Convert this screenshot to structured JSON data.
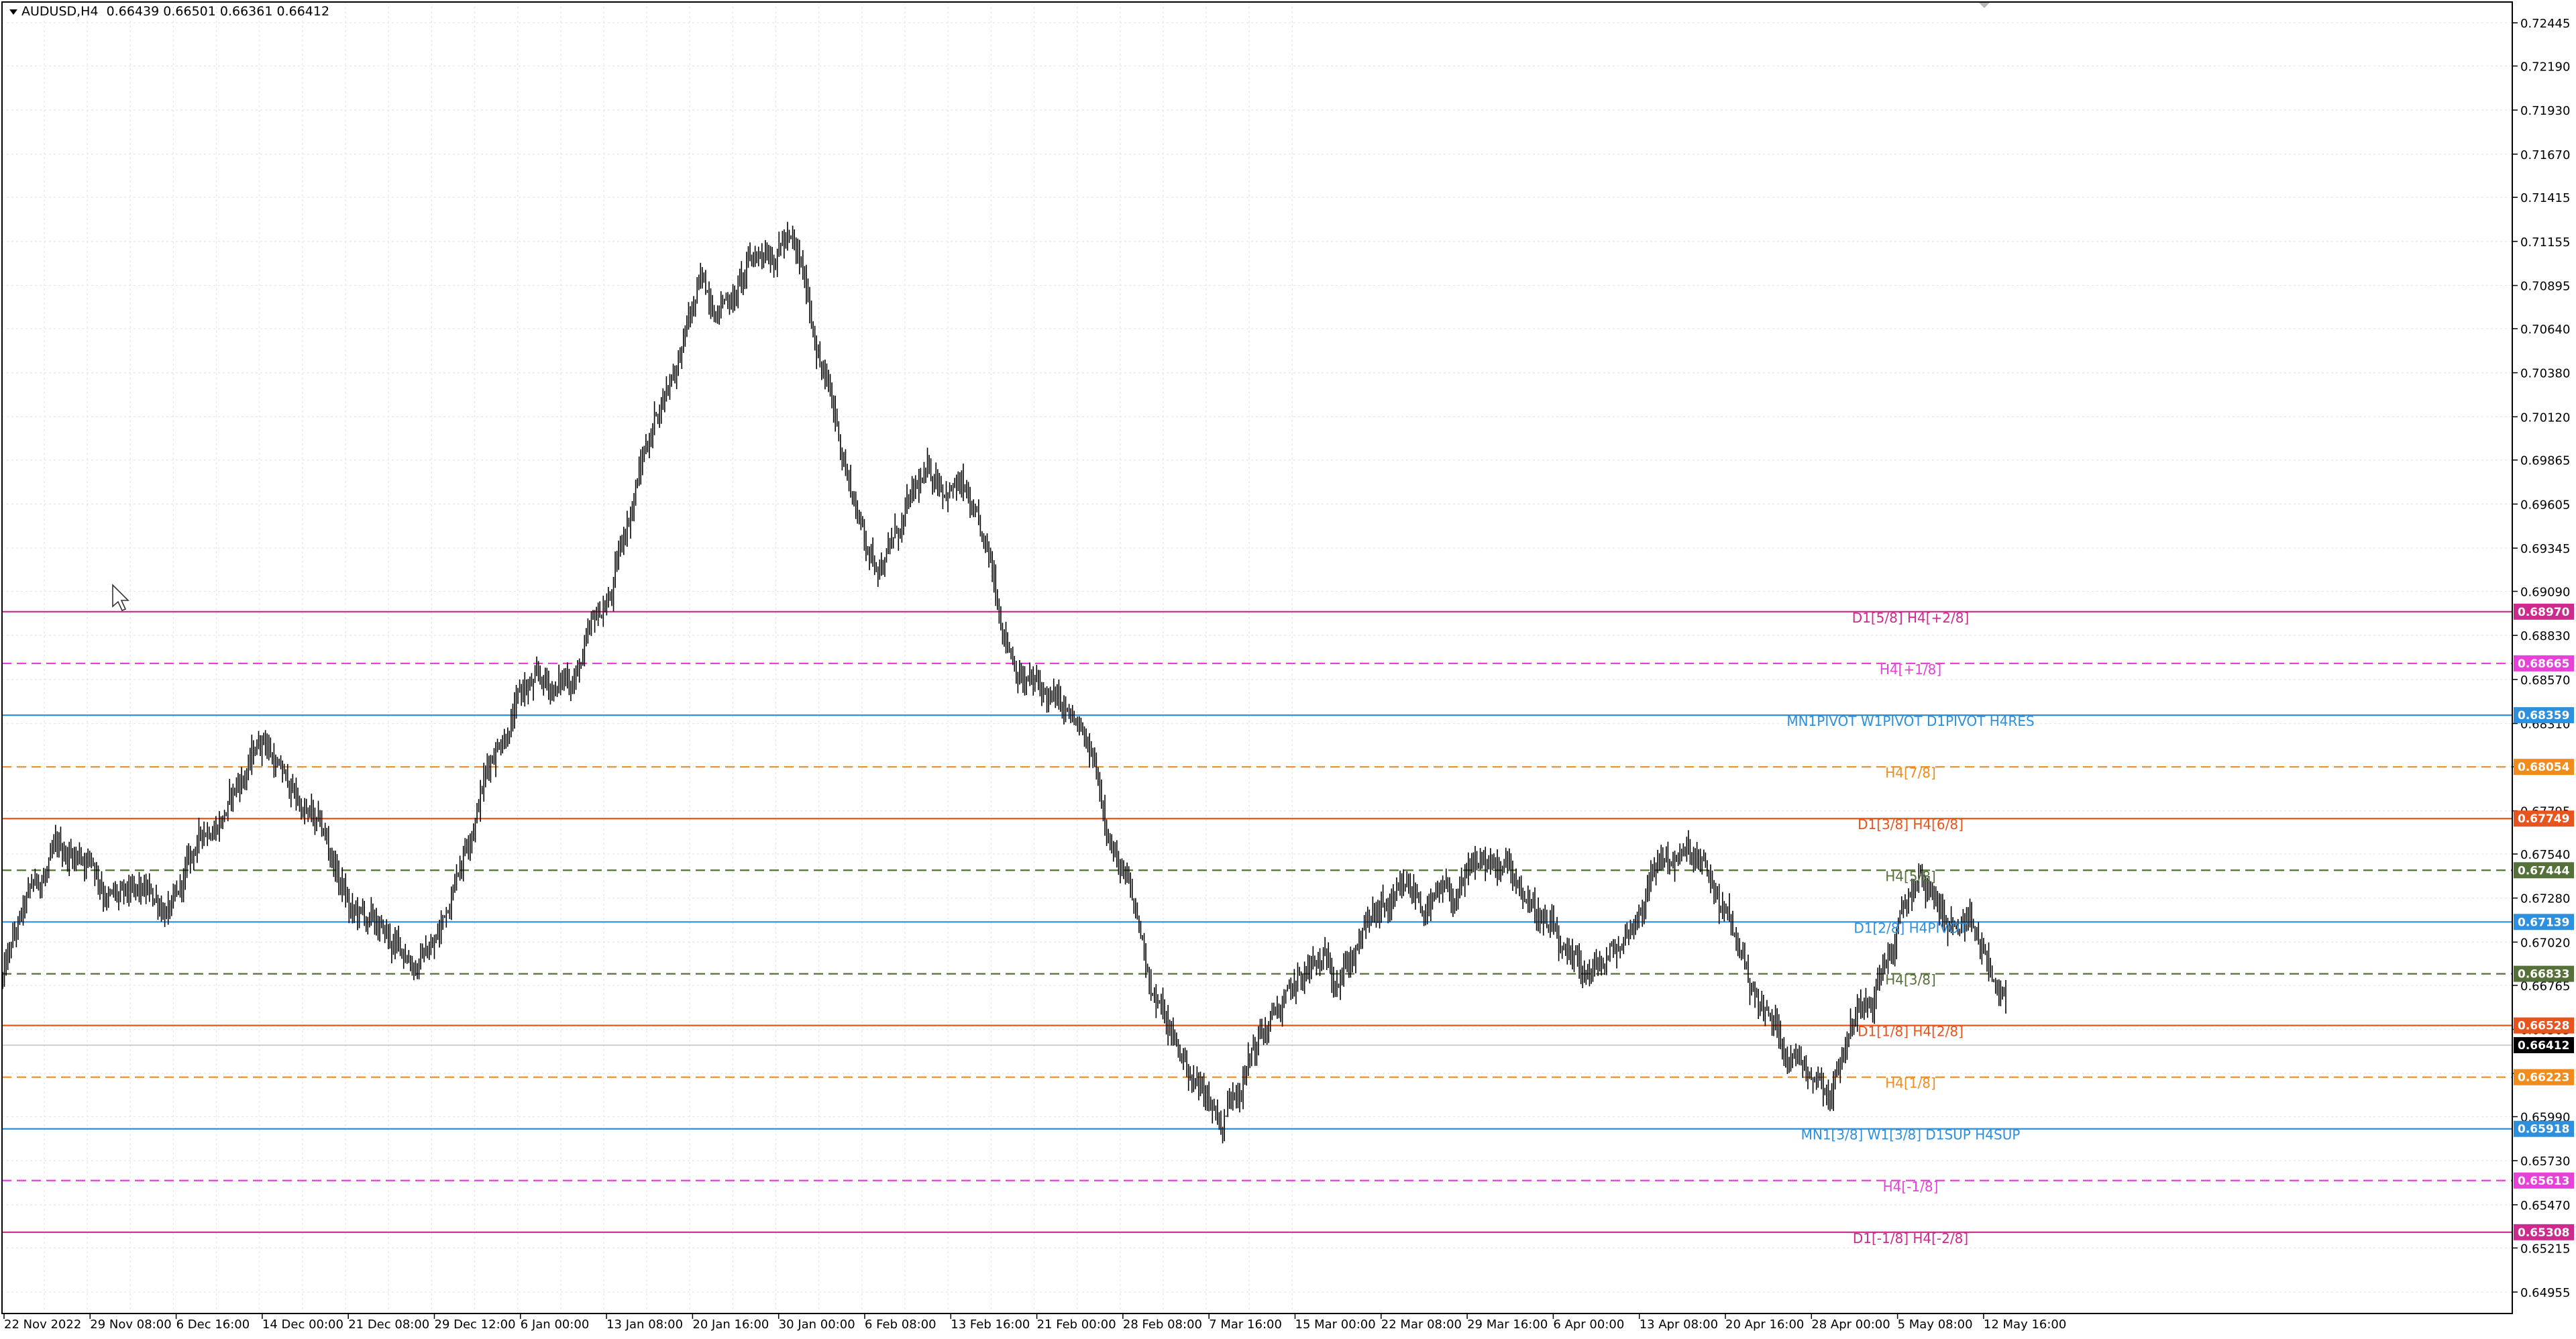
{
  "header": {
    "symbol_label": "AUDUSD,H4",
    "ohlc": "0.66439 0.66501 0.66361 0.66412"
  },
  "price_axis": {
    "ticks": [
      "0.72445",
      "0.72190",
      "0.71930",
      "0.71670",
      "0.71415",
      "0.71155",
      "0.70895",
      "0.70640",
      "0.70380",
      "0.70120",
      "0.69865",
      "0.69605",
      "0.69345",
      "0.69090",
      "0.68830",
      "0.68570",
      "0.68310",
      "0.68055",
      "0.67795",
      "0.67540",
      "0.67280",
      "0.67020",
      "0.66765",
      "0.66505",
      "0.66245",
      "0.65990",
      "0.65730",
      "0.65470",
      "0.65215",
      "0.64955"
    ],
    "range": [
      0.6475,
      0.7258
    ],
    "current_price": "0.66412"
  },
  "time_axis": {
    "labels": [
      "22 Nov 2022",
      "29 Nov 08:00",
      "6 Dec 16:00",
      "14 Dec 00:00",
      "21 Dec 08:00",
      "29 Dec 12:00",
      "6 Jan 00:00",
      "13 Jan 08:00",
      "20 Jan 16:00",
      "30 Jan 00:00",
      "6 Feb 08:00",
      "13 Feb 16:00",
      "21 Feb 00:00",
      "28 Feb 08:00",
      "7 Mar 16:00",
      "15 Mar 00:00",
      "22 Mar 08:00",
      "29 Mar 16:00",
      "6 Apr 00:00",
      "13 Apr 08:00",
      "20 Apr 16:00",
      "28 Apr 00:00",
      "5 May 08:00",
      "12 May 16:00"
    ]
  },
  "levels": [
    {
      "price": 0.6897,
      "badge": "0.68970",
      "label": "D1[5/8] H4[+2/8]",
      "color": "#cc2a8c",
      "style": "solid"
    },
    {
      "price": 0.68665,
      "badge": "0.68665",
      "label": "H4[+1/8]",
      "color": "#e542d8",
      "style": "dashed"
    },
    {
      "price": 0.68359,
      "badge": "0.68359",
      "label": "MN1PIVOT W1PIVOT D1PIVOT H4RES",
      "color": "#2e8fdd",
      "style": "solid"
    },
    {
      "price": 0.68054,
      "badge": "0.68054",
      "label": "H4[7/8]",
      "color": "#f08c1e",
      "style": "dashed"
    },
    {
      "price": 0.67749,
      "badge": "0.67749",
      "label": "D1[3/8] H4[6/8]",
      "color": "#e8541e",
      "style": "solid"
    },
    {
      "price": 0.67444,
      "badge": "0.67444",
      "label": "H4[5/8]",
      "color": "#56703a",
      "style": "dashed"
    },
    {
      "price": 0.67139,
      "badge": "0.67139",
      "label": "D1[2/8] H4PIVOT",
      "color": "#2e8fdd",
      "style": "solid"
    },
    {
      "price": 0.66833,
      "badge": "0.66833",
      "label": "H4[3/8]",
      "color": "#56703a",
      "style": "dashed"
    },
    {
      "price": 0.66528,
      "badge": "0.66528",
      "label": "D1[1/8] H4[2/8]",
      "color": "#e8541e",
      "style": "solid"
    },
    {
      "price": 0.66223,
      "badge": "0.66223",
      "label": "H4[1/8]",
      "color": "#f08c1e",
      "style": "dashed"
    },
    {
      "price": 0.65918,
      "badge": "0.65918",
      "label": "MN1[3/8] W1[3/8] D1SUP H4SUP",
      "color": "#2e8fdd",
      "style": "solid"
    },
    {
      "price": 0.65613,
      "badge": "0.65613",
      "label": "H4[-1/8]",
      "color": "#e542d8",
      "style": "dashed"
    },
    {
      "price": 0.65308,
      "badge": "0.65308",
      "label": "D1[-1/8] H4[-2/8]",
      "color": "#cc2a8c",
      "style": "solid"
    }
  ],
  "chart_data": {
    "type": "line",
    "symbol": "AUDUSD",
    "timeframe": "H4",
    "x": [
      "22 Nov 2022",
      "29 Nov 08:00",
      "6 Dec 16:00",
      "14 Dec 00:00",
      "21 Dec 08:00",
      "29 Dec 12:00",
      "6 Jan 00:00",
      "13 Jan 08:00",
      "20 Jan 16:00",
      "30 Jan 00:00",
      "6 Feb 08:00",
      "13 Feb 16:00",
      "21 Feb 00:00",
      "28 Feb 08:00",
      "7 Mar 16:00",
      "15 Mar 00:00",
      "22 Mar 08:00",
      "29 Mar 16:00",
      "6 Apr 00:00",
      "13 Apr 08:00",
      "20 Apr 16:00",
      "28 Apr 00:00",
      "5 May 08:00",
      "12 May 16:00"
    ],
    "series": [
      {
        "values": [
          0.668,
          0.6765,
          0.6705,
          0.6845,
          0.67,
          0.6715,
          0.685,
          0.69,
          0.71,
          0.7105,
          0.6945,
          0.696,
          0.685,
          0.672,
          0.6585,
          0.67,
          0.67,
          0.676,
          0.667,
          0.675,
          0.67,
          0.6605,
          0.676,
          0.6641
        ]
      }
    ],
    "ylim": [
      0.6475,
      0.7258
    ],
    "grid": true,
    "legend": "none"
  },
  "colors": {
    "candle": "#000000",
    "grid": "#e6e6e6",
    "current_price_badge": "#000000"
  },
  "icons": {
    "cursor": "mouse-pointer-icon"
  }
}
